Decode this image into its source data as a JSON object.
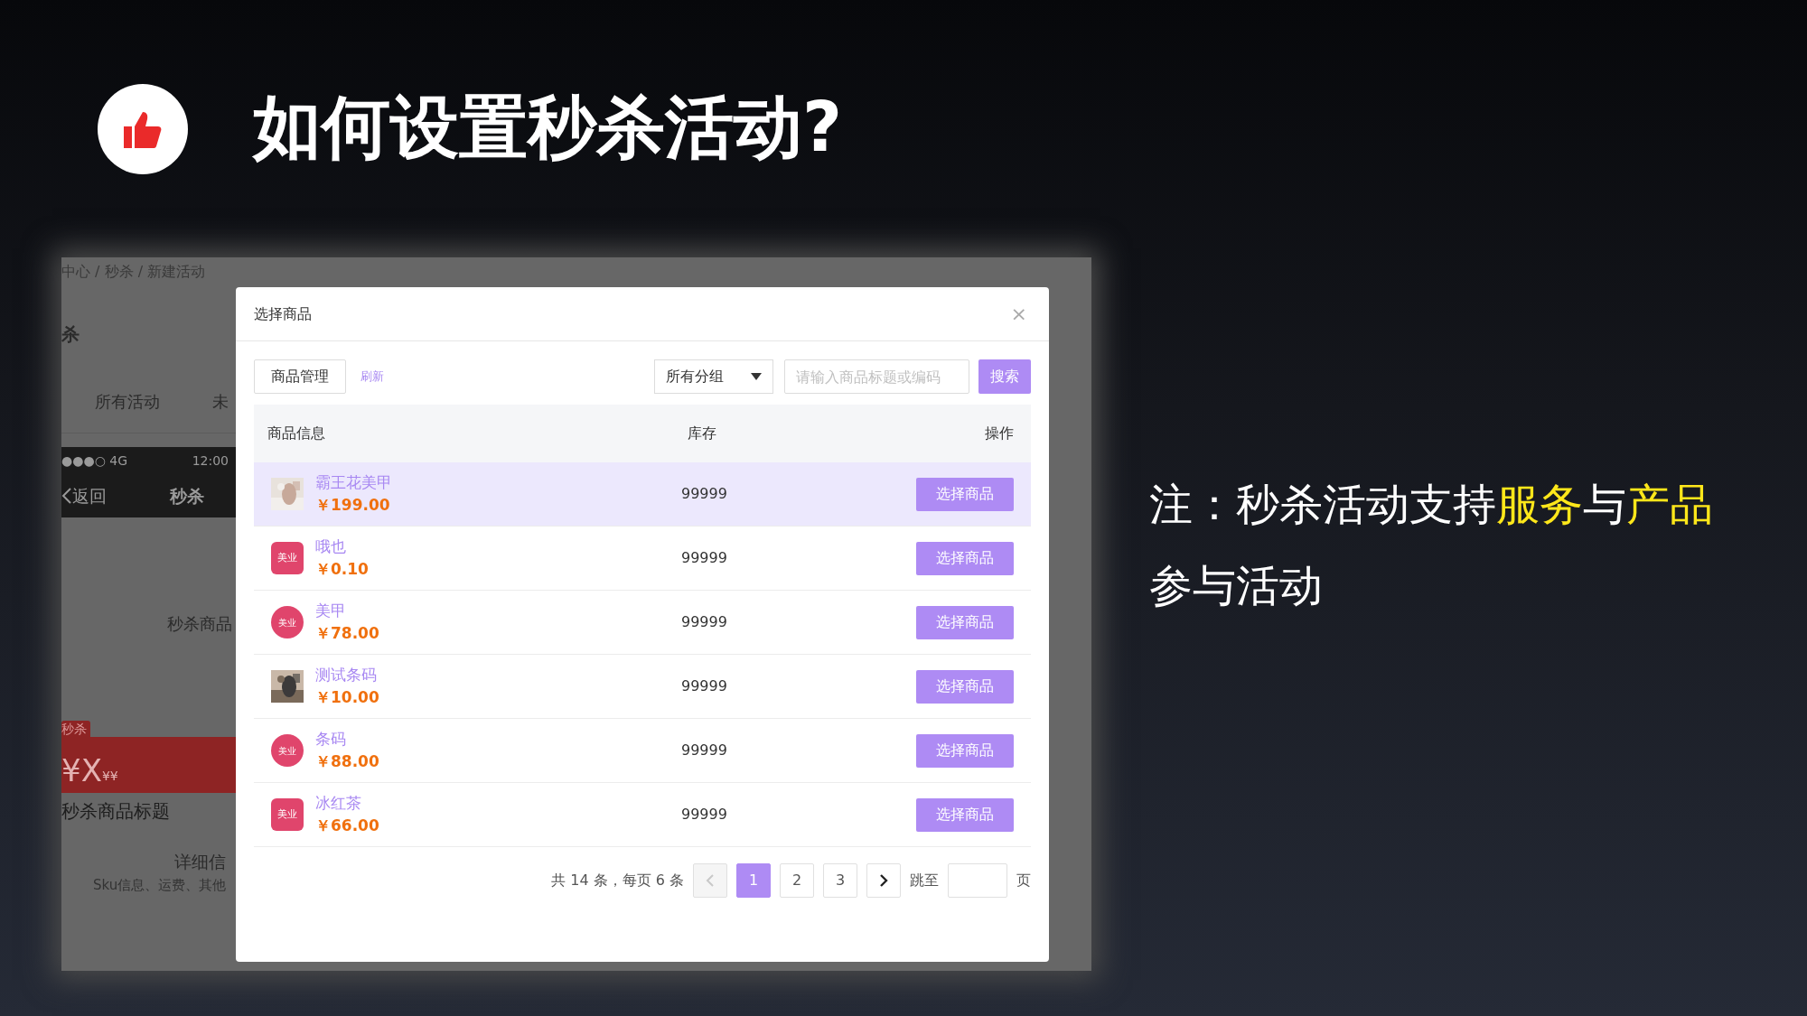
{
  "slide": {
    "title": "如何设置秒杀活动?"
  },
  "background_page": {
    "breadcrumb": "中心 / 秒杀 / 新建活动",
    "heading": "杀",
    "tabs": [
      "所有活动",
      "未"
    ],
    "phone": {
      "signal": "●●●○ 4G",
      "time": "12:00",
      "back": "返回",
      "title": "秒杀"
    },
    "product_label": "秒杀商品",
    "tag": "秒杀",
    "price": "¥X",
    "price_small": "¥¥",
    "product_title": "秒杀商品标题",
    "detail_title": "详细信",
    "detail_text": "Sku信息、运费、其他"
  },
  "modal": {
    "title": "选择商品",
    "close": "×",
    "manage_button": "商品管理",
    "refresh_link": "刷新",
    "group_select": "所有分组",
    "search": {
      "placeholder": "请输入商品标题或编码"
    },
    "search_button": "搜索",
    "columns": [
      "商品信息",
      "库存",
      "操作"
    ],
    "rows": [
      {
        "name": "霸王花美甲",
        "price": "￥199.00",
        "stock": "99999",
        "action": "选择商品",
        "selected": true
      },
      {
        "name": "哦也",
        "price": "￥0.10",
        "stock": "99999",
        "action": "选择商品",
        "selected": false,
        "thumb": {
          "kind": "square-logo",
          "text": "美业"
        }
      },
      {
        "name": "美甲",
        "price": "￥78.00",
        "stock": "99999",
        "action": "选择商品",
        "selected": false,
        "thumb": {
          "kind": "round-logo",
          "text": "美业"
        }
      },
      {
        "name": "测试条码",
        "price": "￥10.00",
        "stock": "99999",
        "action": "选择商品",
        "selected": false
      },
      {
        "name": "条码",
        "price": "￥88.00",
        "stock": "99999",
        "action": "选择商品",
        "selected": false,
        "thumb": {
          "kind": "round-logo",
          "text": "美业"
        }
      },
      {
        "name": "冰红茶",
        "price": "￥66.00",
        "stock": "99999",
        "action": "选择商品",
        "selected": false,
        "thumb": {
          "kind": "square-logo",
          "text": "美业"
        }
      }
    ],
    "pagination": {
      "summary": "共 14 条，每页 6 条",
      "prev_disabled": true,
      "pages": [
        {
          "label": "1",
          "selected": true
        },
        {
          "label": "2",
          "selected": false
        },
        {
          "label": "3",
          "selected": false
        }
      ],
      "jump_label": "跳至",
      "page_unit": "页"
    }
  },
  "note": {
    "lines": [
      [
        {
          "text": "注：秒杀活动支持",
          "highlight": false
        },
        {
          "text": "服务",
          "highlight": true
        },
        {
          "text": "与",
          "highlight": false
        },
        {
          "text": "产品",
          "highlight": true
        }
      ],
      [
        {
          "text": "参与活动",
          "highlight": false
        }
      ]
    ]
  }
}
